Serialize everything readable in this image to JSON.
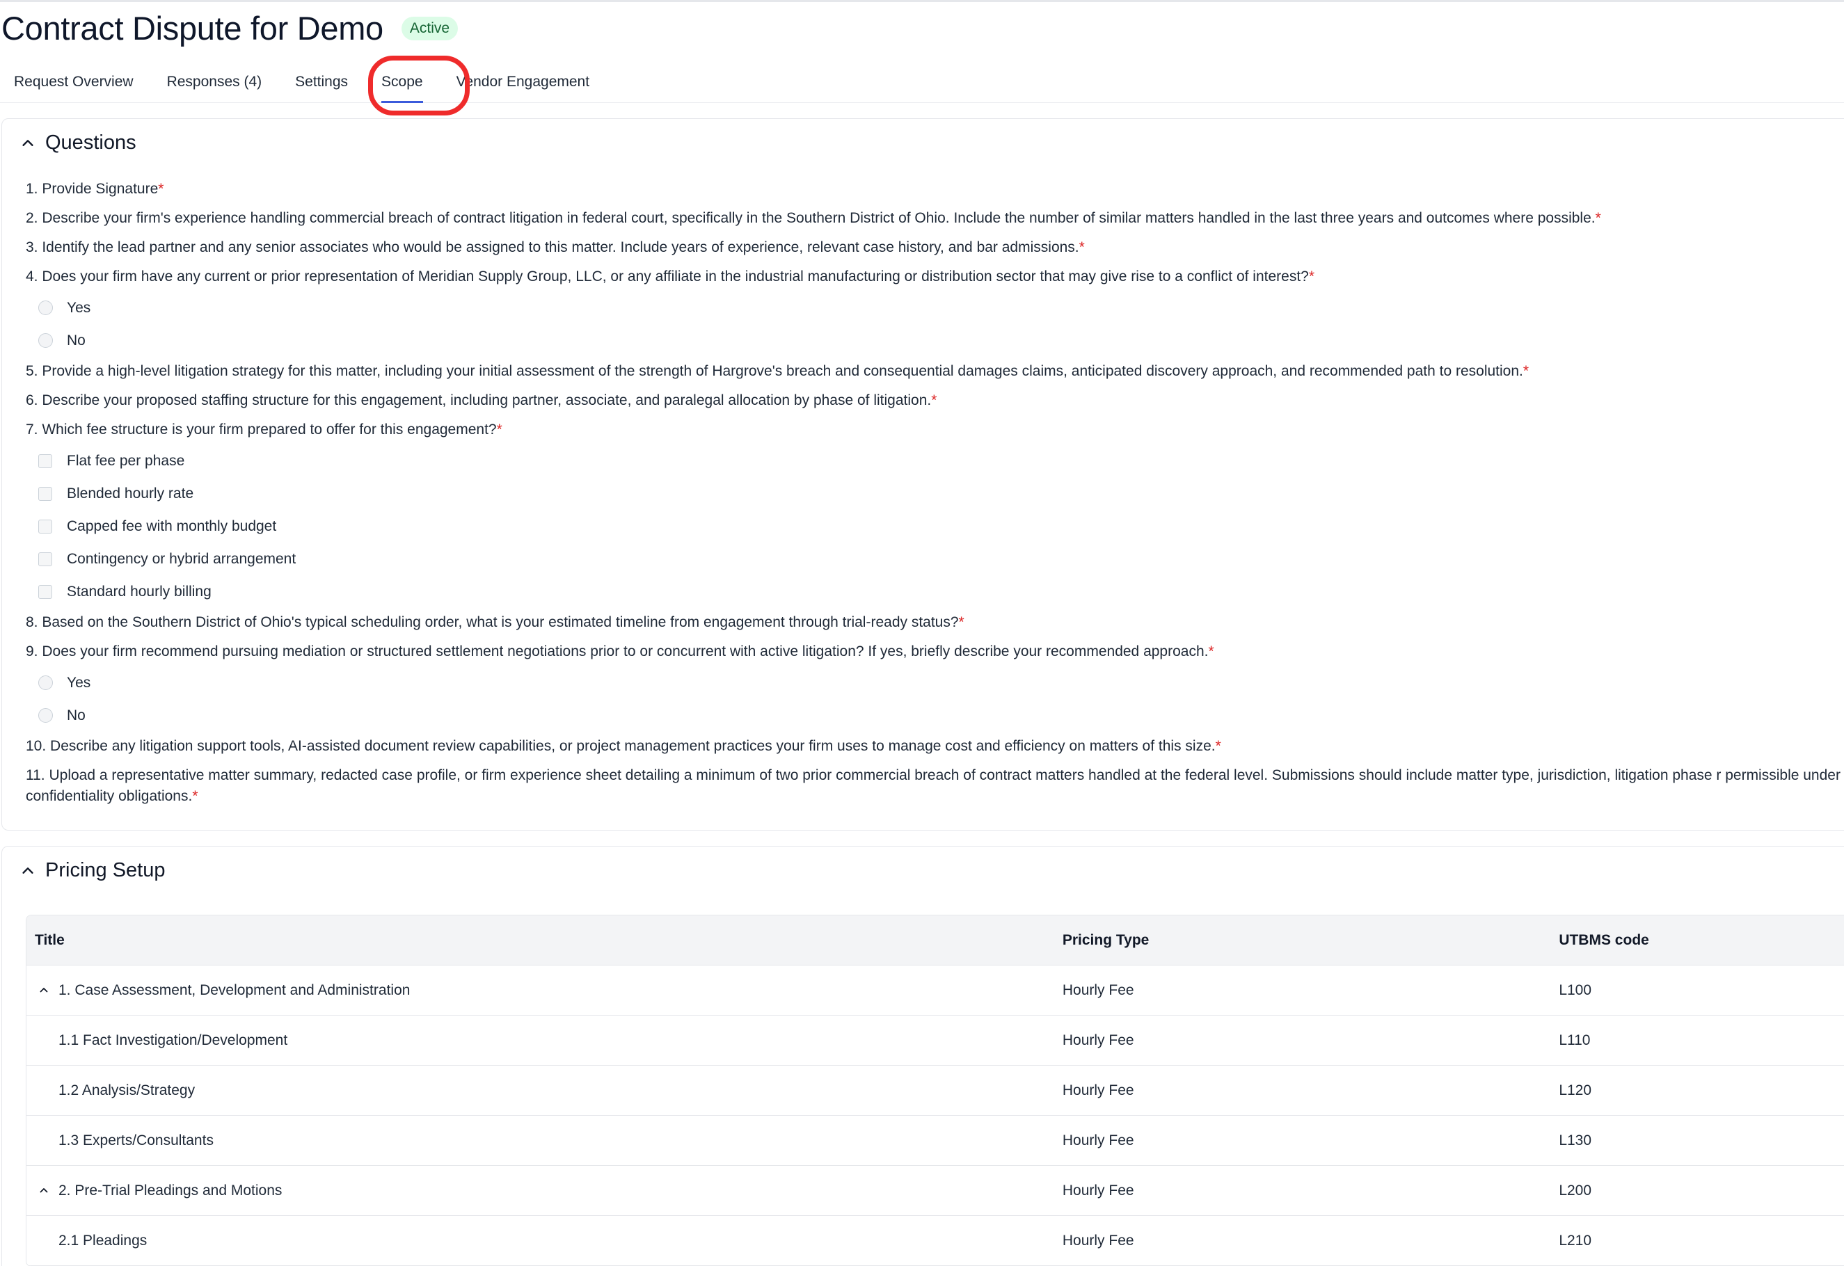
{
  "header": {
    "title": "Contract Dispute for Demo",
    "status": "Active"
  },
  "tabs": [
    {
      "label": "Request Overview"
    },
    {
      "label": "Responses (4)"
    },
    {
      "label": "Settings"
    },
    {
      "label": "Scope",
      "active": true
    },
    {
      "label": "Vendor Engagement"
    }
  ],
  "questions_section": {
    "title": "Questions",
    "required_marker": "*",
    "q1": "1. Provide Signature",
    "q2": "2. Describe your firm's experience handling commercial breach of contract litigation in federal court, specifically in the Southern District of Ohio. Include the number of similar matters handled in the last three years and outcomes where possible.",
    "q3": "3. Identify the lead partner and any senior associates who would be assigned to this matter. Include years of experience, relevant case history, and bar admissions.",
    "q4": "4. Does your firm have any current or prior representation of Meridian Supply Group, LLC, or any affiliate in the industrial manufacturing or distribution sector that may give rise to a conflict of interest?",
    "q4_options": [
      "Yes",
      "No"
    ],
    "q5": "5. Provide a high-level litigation strategy for this matter, including your initial assessment of the strength of Hargrove's breach and consequential damages claims, anticipated discovery approach, and recommended path to resolution.",
    "q6": "6. Describe your proposed staffing structure for this engagement, including partner, associate, and paralegal allocation by phase of litigation.",
    "q7": "7. Which fee structure is your firm prepared to offer for this engagement?",
    "q7_options": [
      "Flat fee per phase",
      "Blended hourly rate",
      "Capped fee with monthly budget",
      "Contingency or hybrid arrangement",
      "Standard hourly billing"
    ],
    "q8": "8. Based on the Southern District of Ohio's typical scheduling order, what is your estimated timeline from engagement through trial-ready status?",
    "q9": "9. Does your firm recommend pursuing mediation or structured settlement negotiations prior to or concurrent with active litigation? If yes, briefly describe your recommended approach.",
    "q9_options": [
      "Yes",
      "No"
    ],
    "q10": "10. Describe any litigation support tools, AI-assisted document review capabilities, or project management practices your firm uses to manage cost and efficiency on matters of this size.",
    "q11": "11. Upload a representative matter summary, redacted case profile, or firm experience sheet detailing a minimum of two prior commercial breach of contract matters handled at the federal level. Submissions should include matter type, jurisdiction, litigation phase r permissible under confidentiality obligations."
  },
  "pricing_section": {
    "title": "Pricing Setup",
    "columns": {
      "title": "Title",
      "pricing_type": "Pricing Type",
      "utbms": "UTBMS code"
    },
    "rows": [
      {
        "title": "1. Case Assessment, Development and Administration",
        "pricing_type": "Hourly Fee",
        "utbms": "L100",
        "parent": true
      },
      {
        "title": "1.1 Fact Investigation/Development",
        "pricing_type": "Hourly Fee",
        "utbms": "L110"
      },
      {
        "title": "1.2 Analysis/Strategy",
        "pricing_type": "Hourly Fee",
        "utbms": "L120"
      },
      {
        "title": "1.3 Experts/Consultants",
        "pricing_type": "Hourly Fee",
        "utbms": "L130"
      },
      {
        "title": "2. Pre-Trial Pleadings and Motions",
        "pricing_type": "Hourly Fee",
        "utbms": "L200",
        "parent": true
      },
      {
        "title": "2.1 Pleadings",
        "pricing_type": "Hourly Fee",
        "utbms": "L210"
      }
    ]
  },
  "icons": {
    "collapse": "chevron-up-icon"
  },
  "colors": {
    "accent": "#3b5bdb",
    "highlight": "#ef2b2b",
    "required": "#dc2626",
    "badge_bg": "#dcfce7",
    "badge_text": "#166534"
  }
}
